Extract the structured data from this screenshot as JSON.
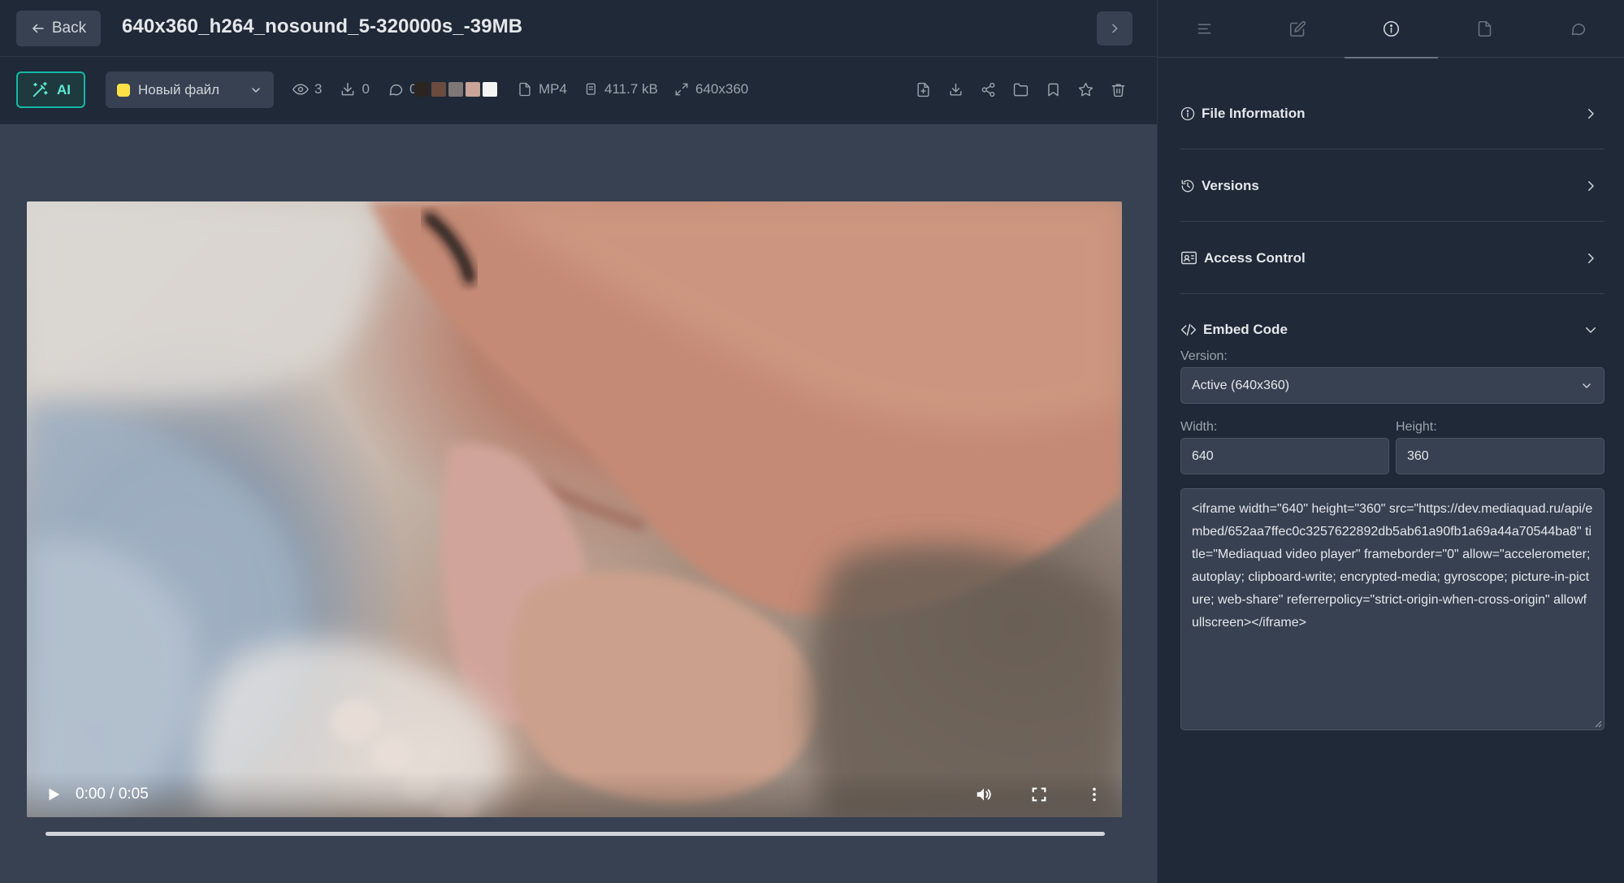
{
  "header": {
    "back_label": "Back",
    "file_title": "640x360_h264_nosound_5-320000s_-39MB"
  },
  "toolbar": {
    "ai_label": "AI",
    "status_label": "Новый файл",
    "status_color": "#fde047",
    "views": "3",
    "downloads": "0",
    "comments": "0",
    "palette": [
      "#2b2521",
      "#6b4b3e",
      "#7d7775",
      "#c9a497",
      "#f4f4f4"
    ],
    "format": "MP4",
    "size": "411.7 kB",
    "dimensions": "640x360",
    "actions": [
      "file-add-icon",
      "download-icon",
      "share-icon",
      "folder-icon",
      "bookmark-icon",
      "star-icon",
      "trash-icon"
    ]
  },
  "player": {
    "time": "0:00 / 0:05",
    "progress": 0
  },
  "panel": {
    "tabs": [
      "list-icon",
      "edit-icon",
      "info-icon",
      "document-icon",
      "comment-icon"
    ],
    "active_tab": "info-icon",
    "sections": {
      "file_info": "File Information",
      "versions": "Versions",
      "access": "Access Control",
      "embed": "Embed Code"
    },
    "embed": {
      "version_label": "Version:",
      "version_value": "Active (640x360)",
      "width_label": "Width:",
      "width_value": "640",
      "height_label": "Height:",
      "height_value": "360",
      "code": "<iframe width=\"640\" height=\"360\" src=\"https://dev.mediaquad.ru/api/embed/652aa7ffec0c3257622892db5ab61a90fb1a69a44a70544ba8\" title=\"Mediaquad video player\" frameborder=\"0\" allow=\"accelerometer; autoplay; clipboard-write; encrypted-media; gyroscope; picture-in-picture; web-share\" referrerpolicy=\"strict-origin-when-cross-origin\" allowfullscreen></iframe>"
    }
  }
}
